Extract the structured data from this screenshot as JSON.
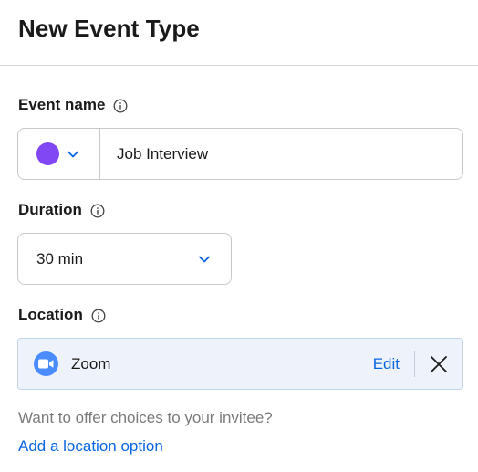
{
  "header": {
    "title": "New Event Type"
  },
  "event_name": {
    "label": "Event name",
    "color": "#8247f5",
    "value": "Job Interview"
  },
  "duration": {
    "label": "Duration",
    "selected": "30 min"
  },
  "location": {
    "label": "Location",
    "selected_name": "Zoom",
    "edit_label": "Edit",
    "hint": "Want to offer choices to your invitee?",
    "add_option_label": "Add a location option"
  },
  "colors": {
    "link": "#0b66e4",
    "zoom_brand": "#4a8cff",
    "location_bg": "#eef3fb"
  },
  "icons": {
    "info": "info-icon",
    "chevron": "chevron-down-icon",
    "zoom": "zoom-camera-icon",
    "close": "close-icon"
  }
}
